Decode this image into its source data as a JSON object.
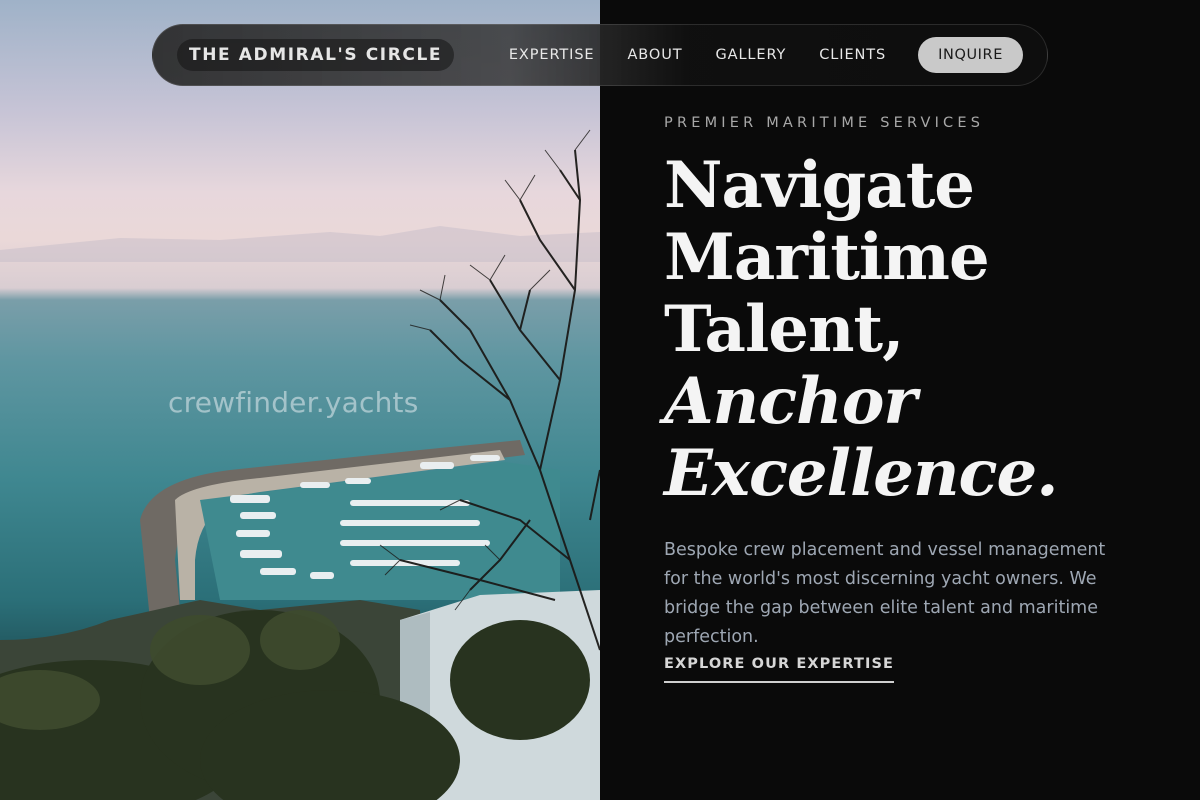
{
  "brand": {
    "name": "THE ADMIRAL'S CIRCLE"
  },
  "nav": {
    "links": [
      "EXPERTISE",
      "ABOUT",
      "GALLERY",
      "CLIENTS"
    ],
    "cta": "INQUIRE"
  },
  "hero": {
    "eyebrow": "PREMIER MARITIME SERVICES",
    "headline": [
      "Navigate",
      "Maritime",
      "Talent,"
    ],
    "headline_italic": [
      "Anchor",
      "Excellence."
    ],
    "description": "Bespoke crew placement and vessel management for the world's most discerning yacht owners. We bridge the gap between elite talent and maritime perfection.",
    "cta": "EXPLORE OUR EXPERTISE"
  },
  "photo": {
    "watermark": "crewfinder.yachts"
  },
  "colors": {
    "background": "#0a0a0a",
    "headline": "#f4f4f4",
    "body_text": "#9ea7b3",
    "eyebrow": "#a8a8a8",
    "cta_button": "#c9c9c9"
  }
}
